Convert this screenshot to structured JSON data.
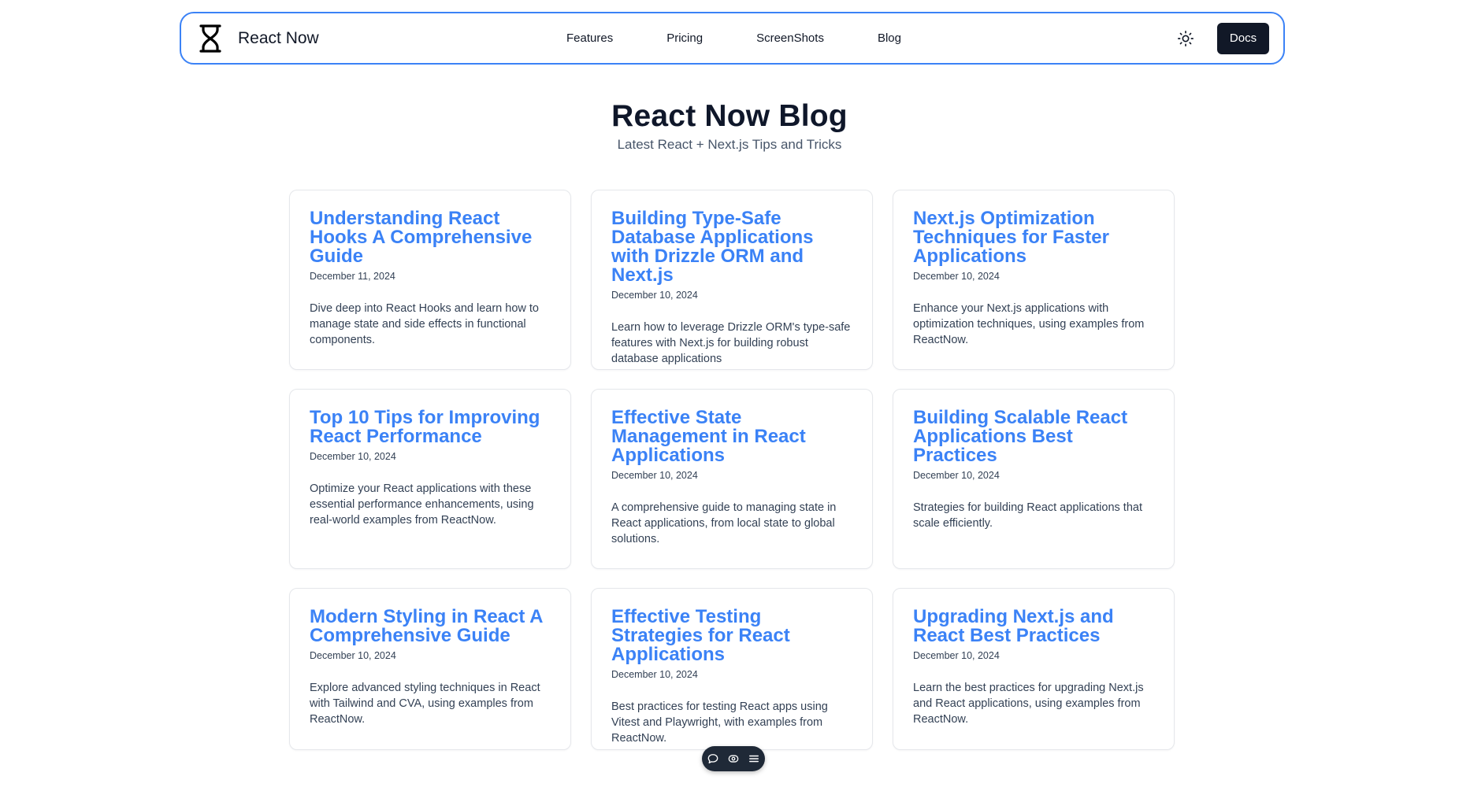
{
  "nav": {
    "brand": "React Now",
    "links": [
      "Features",
      "Pricing",
      "ScreenShots",
      "Blog"
    ],
    "docs_label": "Docs"
  },
  "header": {
    "title": "React Now Blog",
    "subtitle": "Latest React + Next.js Tips and Tricks"
  },
  "posts": [
    {
      "title": "Understanding React Hooks A Comprehensive Guide",
      "date": "December 11, 2024",
      "description": "Dive deep into React Hooks and learn how to manage state and side effects in functional components."
    },
    {
      "title": "Building Type-Safe Database Applications with Drizzle ORM and Next.js",
      "date": "December 10, 2024",
      "description": "Learn how to leverage Drizzle ORM's type-safe features with Next.js for building robust database applications"
    },
    {
      "title": "Next.js Optimization Techniques for Faster Applications",
      "date": "December 10, 2024",
      "description": "Enhance your Next.js applications with optimization techniques, using examples from ReactNow."
    },
    {
      "title": "Top 10 Tips for Improving React Performance",
      "date": "December 10, 2024",
      "description": "Optimize your React applications with these essential performance enhancements, using real-world examples from ReactNow."
    },
    {
      "title": "Effective State Management in React Applications",
      "date": "December 10, 2024",
      "description": "A comprehensive guide to managing state in React applications, from local state to global solutions."
    },
    {
      "title": "Building Scalable React Applications Best Practices",
      "date": "December 10, 2024",
      "description": "Strategies for building React applications that scale efficiently."
    },
    {
      "title": "Modern Styling in React A Comprehensive Guide",
      "date": "December 10, 2024",
      "description": "Explore advanced styling techniques in React with Tailwind and CVA, using examples from ReactNow."
    },
    {
      "title": "Effective Testing Strategies for React Applications",
      "date": "December 10, 2024",
      "description": "Best practices for testing React apps using Vitest and Playwright, with examples from ReactNow."
    },
    {
      "title": "Upgrading Next.js and React Best Practices",
      "date": "December 10, 2024",
      "description": "Learn the best practices for upgrading Next.js and React applications, using examples from ReactNow."
    }
  ],
  "icons": {
    "logo": "hourglass-icon",
    "theme_toggle": "sun-icon",
    "toolbar": [
      "chat-icon",
      "eye-icon",
      "menu-icon"
    ]
  },
  "colors": {
    "accent": "#3b82f6",
    "dark": "#111827"
  }
}
